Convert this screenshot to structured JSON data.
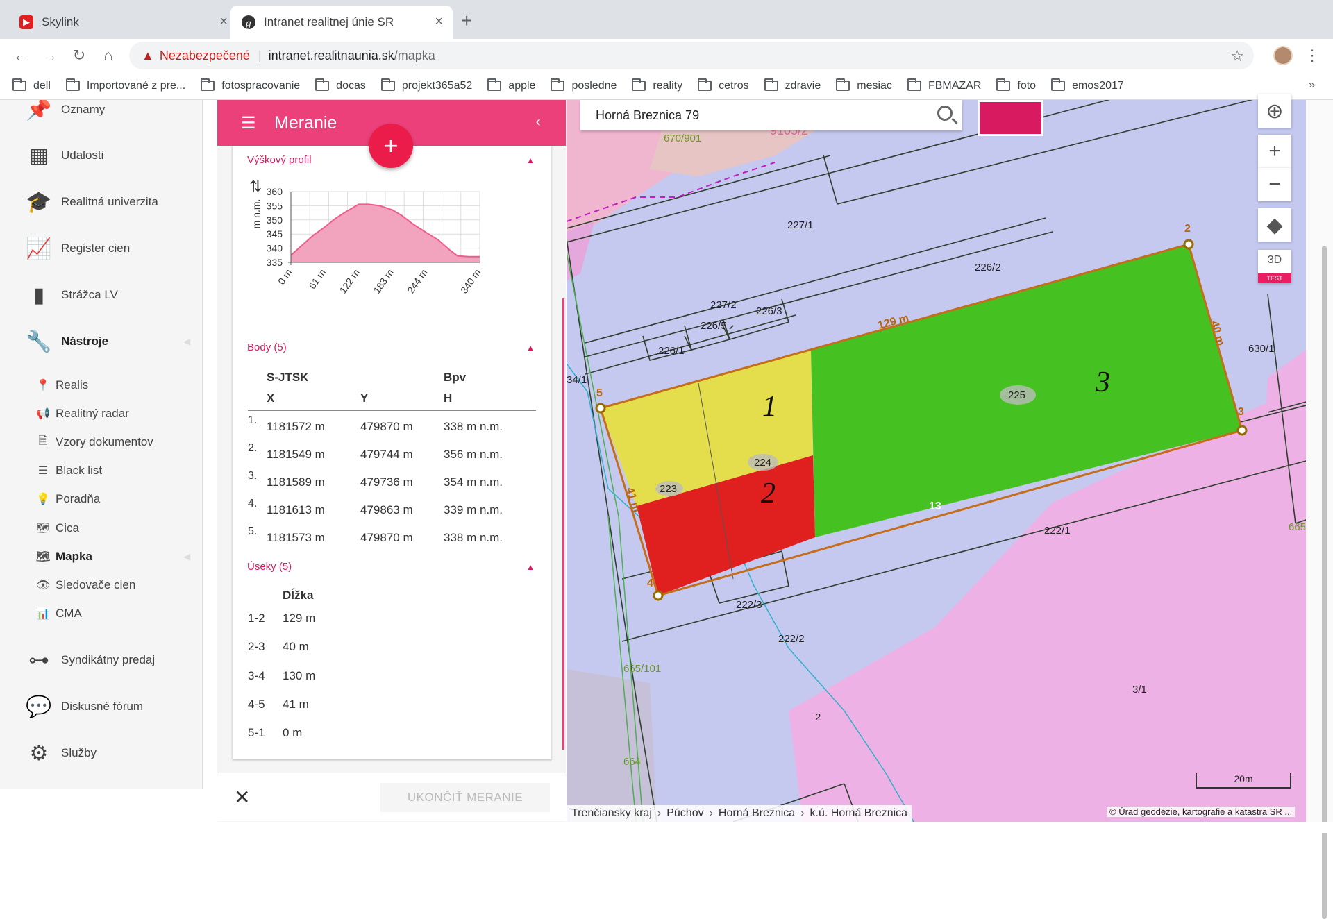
{
  "browser": {
    "tabs": [
      {
        "title": "Skylink",
        "close": "×"
      },
      {
        "title": "Intranet realitnej únie SR",
        "close": "×"
      }
    ],
    "new_tab": "+",
    "address": {
      "warning": "Nezabezpečené",
      "host": "intranet.realitnaunia.sk",
      "path": "/mapka"
    },
    "bookmarks": [
      "dell",
      "Importované z pre...",
      "fotospracovanie",
      "docas",
      "projekt365a52",
      "apple",
      "posledne",
      "reality",
      "cetros",
      "zdravie",
      "mesiac",
      "FBMAZAR",
      "foto",
      "emos2017"
    ],
    "bookmarks_more": "»"
  },
  "sidebar": {
    "items": [
      {
        "label": "Oznamy",
        "icon": "pin-icon"
      },
      {
        "label": "Udalosti",
        "icon": "calendar-icon"
      },
      {
        "label": "Realitná univerzita",
        "icon": "graduation-cap-icon"
      },
      {
        "label": "Register cien",
        "icon": "line-chart-icon"
      },
      {
        "label": "Strážca LV",
        "icon": "document-icon"
      },
      {
        "label": "Nástroje",
        "icon": "wrench-icon"
      }
    ],
    "subitems": [
      {
        "label": "Realis",
        "icon": "map-marker-icon"
      },
      {
        "label": "Realitný radar",
        "icon": "megaphone-icon"
      },
      {
        "label": "Vzory dokumentov",
        "icon": "file-text-icon"
      },
      {
        "label": "Black list",
        "icon": "list-icon"
      },
      {
        "label": "Poradňa",
        "icon": "lightbulb-icon"
      },
      {
        "label": "Cica",
        "icon": "map-icon"
      },
      {
        "label": "Mapka",
        "icon": "map-outline-icon"
      },
      {
        "label": "Sledovače cien",
        "icon": "eye-icon"
      },
      {
        "label": "CMA",
        "icon": "bar-chart-icon"
      }
    ],
    "items2": [
      {
        "label": "Syndikátny predaj",
        "icon": "sitemap-icon"
      },
      {
        "label": "Diskusné fórum",
        "icon": "comments-icon"
      },
      {
        "label": "Služby",
        "icon": "cogs-icon"
      }
    ]
  },
  "panel": {
    "title": "Meranie",
    "fab": "+",
    "profile": {
      "heading": "Výškový profil",
      "ylabel": "m n.m."
    },
    "points": {
      "heading": "Body (5)",
      "col1_top": "S-JTSK",
      "col3_top": "Bpv",
      "col1": "X",
      "col2": "Y",
      "col3": "H",
      "rows": [
        {
          "n": "1.",
          "x": "1181572 m",
          "y": "479870 m",
          "h": "338 m n.m."
        },
        {
          "n": "2.",
          "x": "1181549 m",
          "y": "479744 m",
          "h": "356 m n.m."
        },
        {
          "n": "3.",
          "x": "1181589 m",
          "y": "479736 m",
          "h": "354 m n.m."
        },
        {
          "n": "4.",
          "x": "1181613 m",
          "y": "479863 m",
          "h": "339 m n.m."
        },
        {
          "n": "5.",
          "x": "1181573 m",
          "y": "479870 m",
          "h": "338 m n.m."
        }
      ]
    },
    "segments": {
      "heading": "Úseky (5)",
      "col": "Dĺžka",
      "rows": [
        {
          "id": "1-2",
          "len": "129 m"
        },
        {
          "id": "2-3",
          "len": "40 m"
        },
        {
          "id": "3-4",
          "len": "130 m"
        },
        {
          "id": "4-5",
          "len": "41 m"
        },
        {
          "id": "5-1",
          "len": "0 m"
        }
      ]
    },
    "end_button": "UKONČIŤ MERANIE"
  },
  "chart_data": {
    "type": "area",
    "ylabel": "m n.m.",
    "x_ticks": [
      "0 m",
      "61 m",
      "122 m",
      "183 m",
      "244 m",
      "340 m"
    ],
    "y_ticks": [
      335,
      340,
      345,
      350,
      355,
      360
    ],
    "ylim": [
      335,
      360
    ],
    "xlim": [
      0,
      340
    ],
    "grid": true,
    "color": "#ec5d8d",
    "x": [
      0,
      20,
      40,
      61,
      80,
      100,
      122,
      140,
      160,
      183,
      200,
      220,
      244,
      265,
      285,
      300,
      320,
      340
    ],
    "y": [
      337.5,
      341,
      344.5,
      347.5,
      350.5,
      353,
      355.5,
      355.5,
      355,
      353.5,
      351.5,
      348.5,
      345.5,
      343,
      339.5,
      337.3,
      337,
      337
    ]
  },
  "map": {
    "search_value": "Horná Breznica 79",
    "breadcrumb": [
      "Trenčiansky kraj",
      "Púchov",
      "Horná Breznica",
      "k.ú. Horná Breznica"
    ],
    "copyright": "© Úrad geodézie, kartografie a katastra SR ...",
    "scale": "20m",
    "btn3d": "3D",
    "btn3d_badge": "TEST",
    "parcels": [
      "670/901",
      "9105/2",
      "227/1",
      "226/2",
      "227/2",
      "226/3",
      "226/5",
      "226/1",
      "225",
      "224",
      "223",
      "630/1",
      "222/1",
      "222/3",
      "222/2",
      "665/101",
      "3/1",
      "2",
      "664",
      "34/1",
      "665"
    ],
    "zone_labels": [
      "1",
      "2",
      "3"
    ],
    "vertex_labels": [
      "2",
      "3",
      "4",
      "5"
    ],
    "measure_labels": [
      "129 m",
      "40 m",
      "41 m",
      "13"
    ]
  },
  "colors": {
    "accent": "#ec407a",
    "zone1": "#e5de4c",
    "zone2": "#e0201f",
    "zone3": "#45c221"
  }
}
